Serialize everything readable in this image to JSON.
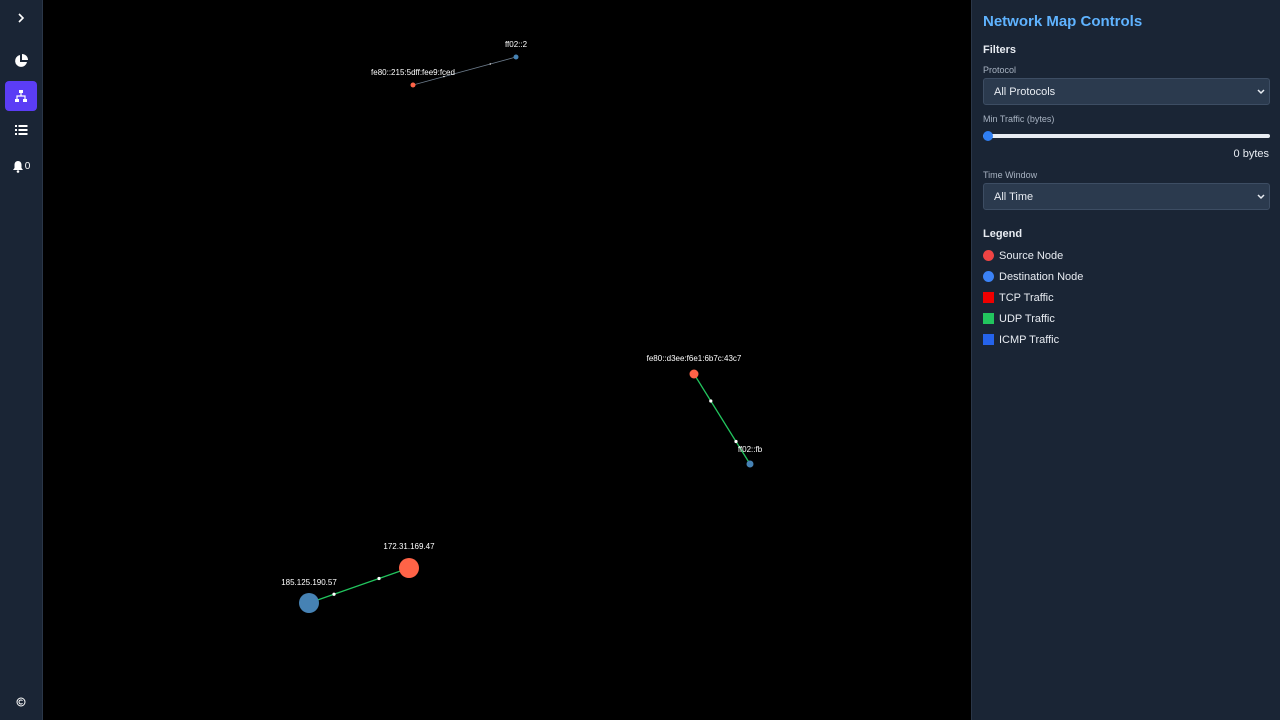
{
  "sidebar": {
    "notification_count": "0",
    "colors": {
      "active": "#5b3df5",
      "icon": "#ffffff"
    },
    "icons": [
      "chevron-right-icon",
      "pie-chart-icon",
      "network-icon",
      "list-icon",
      "bell-icon",
      "copyright-icon"
    ]
  },
  "map": {
    "nodes": [
      {
        "id": "n1",
        "label": "ff02::2",
        "role": "destination",
        "color": "#4682b4"
      },
      {
        "id": "n2",
        "label": "fe80::215:5dff:fee9:fced",
        "role": "source",
        "color": "#ff6347"
      },
      {
        "id": "n3",
        "label": "fe80::d3ee:f6e1:6b7c:43c7",
        "role": "source",
        "color": "#ff6347"
      },
      {
        "id": "n4",
        "label": "ff02::fb",
        "role": "destination",
        "color": "#4682b4"
      },
      {
        "id": "n5",
        "label": "172.31.169.47",
        "role": "source",
        "color": "#ff6347"
      },
      {
        "id": "n6",
        "label": "185.125.190.57",
        "role": "destination",
        "color": "#4682b4"
      }
    ],
    "links": [
      {
        "from": "n2",
        "to": "n1",
        "protocol": "ICMP",
        "color": "#6b7a8a"
      },
      {
        "from": "n3",
        "to": "n4",
        "protocol": "UDP",
        "color": "#22c55e"
      },
      {
        "from": "n5",
        "to": "n6",
        "protocol": "UDP",
        "color": "#22c55e"
      }
    ]
  },
  "panel": {
    "title": "Network Map Controls",
    "filters_heading": "Filters",
    "protocol_label": "Protocol",
    "protocol_value": "All Protocols",
    "min_traffic_label": "Min Traffic (bytes)",
    "min_traffic_value": "0 bytes",
    "min_traffic_fraction": 0,
    "time_window_label": "Time Window",
    "time_window_value": "All Time",
    "legend_heading": "Legend",
    "legend": [
      {
        "label": "Source Node",
        "shape": "circle",
        "color": "#ef4444"
      },
      {
        "label": "Destination Node",
        "shape": "circle",
        "color": "#3b82f6"
      },
      {
        "label": "TCP Traffic",
        "shape": "square",
        "color": "#ef0000"
      },
      {
        "label": "UDP Traffic",
        "shape": "square",
        "color": "#22c55e"
      },
      {
        "label": "ICMP Traffic",
        "shape": "square",
        "color": "#2563eb"
      }
    ]
  }
}
